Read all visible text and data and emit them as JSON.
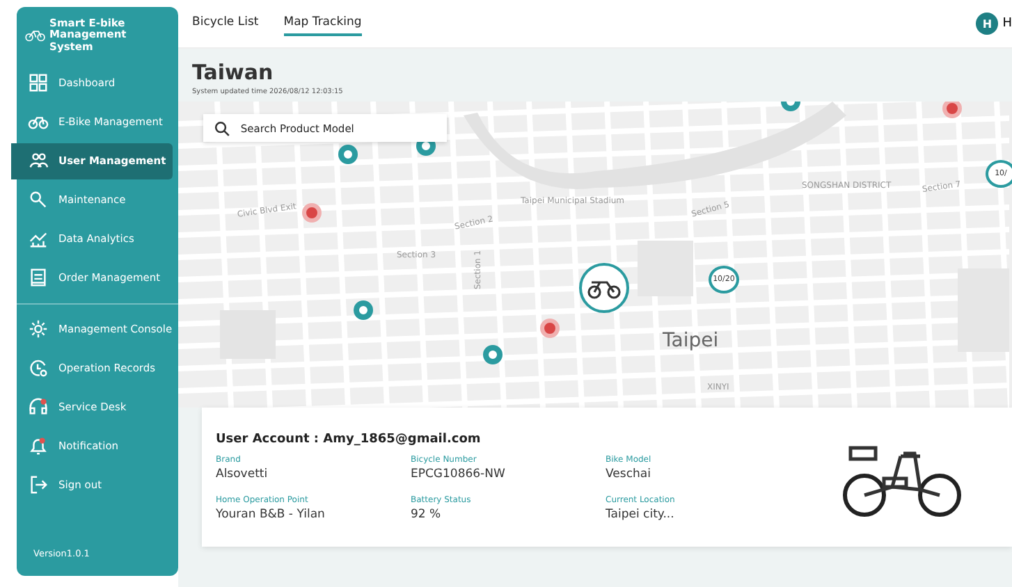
{
  "sidebar": {
    "logo": "Smart E-bike Management System",
    "items": [
      {
        "label": "Dashboard",
        "selected": false
      },
      {
        "label": "E-Bike Management",
        "selected": false
      },
      {
        "label": "User Management",
        "selected": true
      },
      {
        "label": "Maintenance",
        "selected": false
      },
      {
        "label": "Data Analytics",
        "selected": false
      },
      {
        "label": "Order Management",
        "selected": false
      },
      {
        "label": "Management Console",
        "selected": false
      },
      {
        "label": "Operation Records",
        "selected": false
      },
      {
        "label": "Service Desk",
        "selected": false
      },
      {
        "label": "Notification",
        "selected": false
      },
      {
        "label": "Sign out",
        "selected": false
      }
    ],
    "version": "Version1.0.1"
  },
  "tabs": [
    {
      "label": "Bicycle List",
      "selected": false
    },
    {
      "label": "Map Tracking",
      "selected": true
    }
  ],
  "user": {
    "avatar": "H",
    "name": "H"
  },
  "page": {
    "title": "Taiwan",
    "updated": "System updated time 2026/08/12 12:03:15"
  },
  "search": {
    "placeholder": "Search Product Model"
  },
  "map": {
    "labels": [
      "Civic Blvd Exit",
      "Section 3",
      "Section 2",
      "Section 5",
      "Section 7",
      "Section 1",
      "SONGSHAN DISTRICT",
      "Taipei Municipal Stadium",
      "Taipei",
      "XINYI"
    ],
    "markers": [
      {
        "kind": "station"
      },
      {
        "kind": "station"
      },
      {
        "kind": "station"
      },
      {
        "kind": "alert"
      },
      {
        "kind": "station"
      },
      {
        "kind": "station"
      },
      {
        "kind": "alert"
      },
      {
        "kind": "alert"
      },
      {
        "kind": "bike"
      },
      {
        "kind": "count",
        "label": "10/20"
      },
      {
        "kind": "count",
        "label": "10/"
      }
    ]
  },
  "details": {
    "title": "User Account : Amy_1865@gmail.com",
    "fields": [
      {
        "label": "Brand",
        "value": "Alsovetti"
      },
      {
        "label": "Bicycle Number",
        "value": "EPCG10866-NW"
      },
      {
        "label": "Bike Model",
        "value": "Veschai"
      },
      {
        "label": "Home Operation Point",
        "value": "Youran B&B - Yilan"
      },
      {
        "label": "Battery Status",
        "value": "92 %"
      },
      {
        "label": "Current Location",
        "value": "Taipei city..."
      }
    ]
  }
}
